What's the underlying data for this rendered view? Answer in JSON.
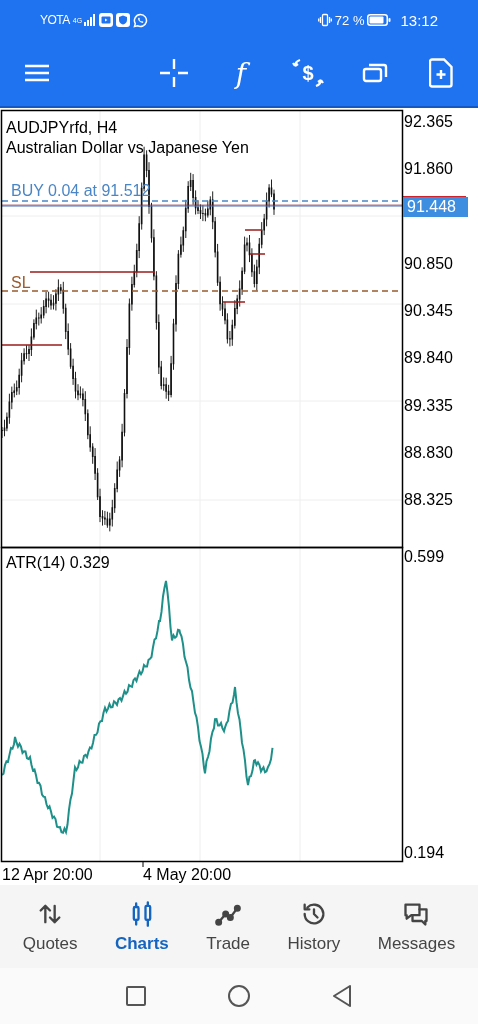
{
  "status_bar": {
    "carrier": "YOTA",
    "network": "4G",
    "battery": "72 %",
    "time": "13:12"
  },
  "toolbar": {
    "buttons": [
      {
        "kind": "menu"
      },
      {
        "kind": "crosshair"
      },
      {
        "kind": "function",
        "glyph": "f"
      },
      {
        "kind": "trade",
        "glyph": "$"
      },
      {
        "kind": "windows"
      },
      {
        "kind": "new-order"
      }
    ]
  },
  "chart": {
    "symbol": "AUDJPYrfd, H4",
    "description": "Australian Dollar vs Japanese Yen",
    "order_label": "BUY 0.04 at 91.512",
    "stop_label": "SL",
    "current_price": "91.448",
    "price_axis": [
      "92.365",
      "91.860",
      "90.850",
      "90.345",
      "89.840",
      "89.335",
      "88.830",
      "88.325"
    ],
    "indicator": {
      "label": "ATR(14) 0.329",
      "axis": [
        "0.599",
        "0.194"
      ]
    },
    "time_axis": [
      "12 Apr 20:00",
      "4 May 20:00"
    ]
  },
  "tabs": [
    {
      "label": "Quotes",
      "kind": "quotes",
      "selected": false
    },
    {
      "label": "Charts",
      "kind": "charts",
      "selected": true
    },
    {
      "label": "Trade",
      "kind": "trade",
      "selected": false
    },
    {
      "label": "History",
      "kind": "history",
      "selected": false
    },
    {
      "label": "Messages",
      "kind": "messages",
      "selected": false
    }
  ]
}
